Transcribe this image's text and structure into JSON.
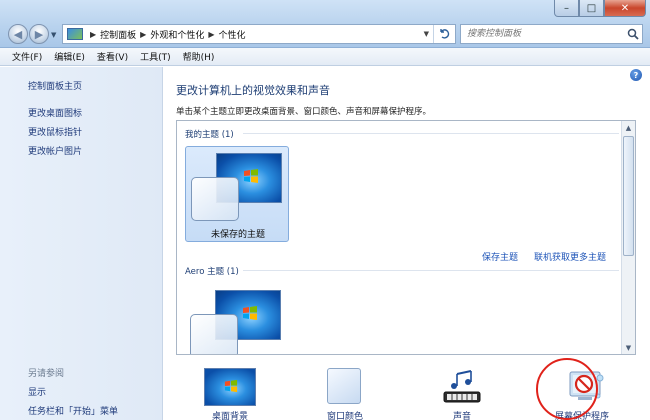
{
  "window": {
    "minimize_glyph": "–",
    "maximize_glyph": "□",
    "close_glyph": "✕"
  },
  "address": {
    "crumbs": [
      "控制面板",
      "外观和个性化",
      "个性化"
    ],
    "search_placeholder": "搜索控制面板"
  },
  "menu": [
    "文件(F)",
    "编辑(E)",
    "查看(V)",
    "工具(T)",
    "帮助(H)"
  ],
  "left_pane": {
    "home": "控制面板主页",
    "links": [
      "更改桌面图标",
      "更改鼠标指针",
      "更改帐户图片"
    ],
    "see_also_title": "另请参阅",
    "see_also": [
      "显示",
      "任务栏和「开始」菜单"
    ]
  },
  "main": {
    "title": "更改计算机上的视觉效果和声音",
    "description": "单击某个主题立即更改桌面背景、窗口颜色、声音和屏幕保护程序。",
    "my_themes_title": "我的主题 (1)",
    "unsaved_theme_label": "未保存的主题",
    "save_theme": "保存主题",
    "get_more_themes": "联机获取更多主题",
    "aero_title": "Aero 主题 (1)"
  },
  "settings": {
    "desktop_background": "桌面背景",
    "window_color": "窗口颜色",
    "sounds": "声音",
    "screen_saver": "屏幕保护程序"
  },
  "icons": {
    "help": "?",
    "search": "search-icon",
    "refresh": "refresh-icon"
  },
  "colors": {
    "link": "#1f55b8",
    "highlight_circle": "#e0221a"
  }
}
